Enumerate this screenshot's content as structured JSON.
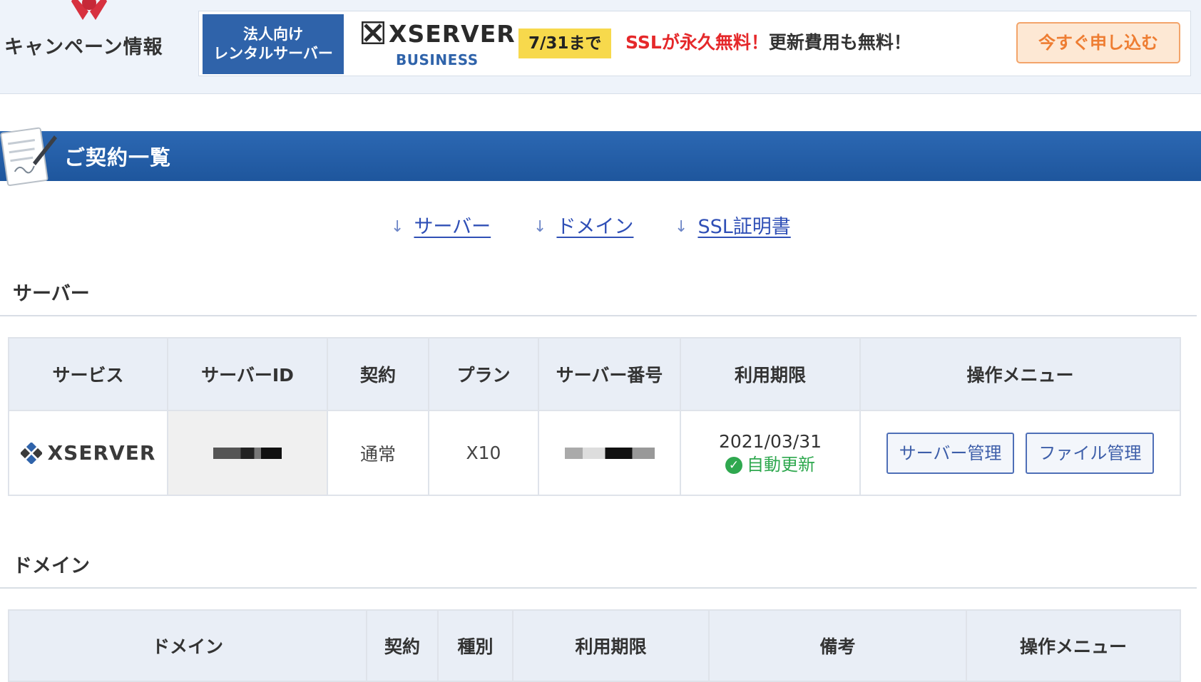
{
  "campaign": {
    "label": "キャンペーン情報",
    "banner": {
      "tag_line1": "法人向け",
      "tag_line2": "レンタルサーバー",
      "brand": "XSERVER",
      "brand_sub": "BUSINESS",
      "date_badge": "7/31まで",
      "promo_red": "SSLが永久無料！",
      "promo_dark": "更新費用も無料！",
      "apply_button": "今すぐ申し込む"
    }
  },
  "heading": {
    "title": "ご契約一覧"
  },
  "anchors": [
    {
      "label": "サーバー"
    },
    {
      "label": "ドメイン"
    },
    {
      "label": "SSL証明書"
    }
  ],
  "server_section": {
    "title": "サーバー",
    "headers": [
      "サービス",
      "サーバーID",
      "契約",
      "プラン",
      "サーバー番号",
      "利用期限",
      "操作メニュー"
    ],
    "row": {
      "service": "XSERVER",
      "contract": "通常",
      "plan": "X10",
      "expiry_date": "2021/03/31",
      "auto_renew": "自動更新",
      "buttons": [
        "サーバー管理",
        "ファイル管理"
      ]
    }
  },
  "domain_section": {
    "title": "ドメイン",
    "headers": [
      "ドメイン",
      "契約",
      "種別",
      "利用期限",
      "備考",
      "操作メニュー"
    ]
  },
  "colors": {
    "heading_blue": "#1e569d",
    "link_blue": "#2f4fb6",
    "promo_red": "#e5282a",
    "badge_yellow": "#f7d94c",
    "renew_green": "#2fa84f",
    "apply_orange": "#ee7d32"
  }
}
